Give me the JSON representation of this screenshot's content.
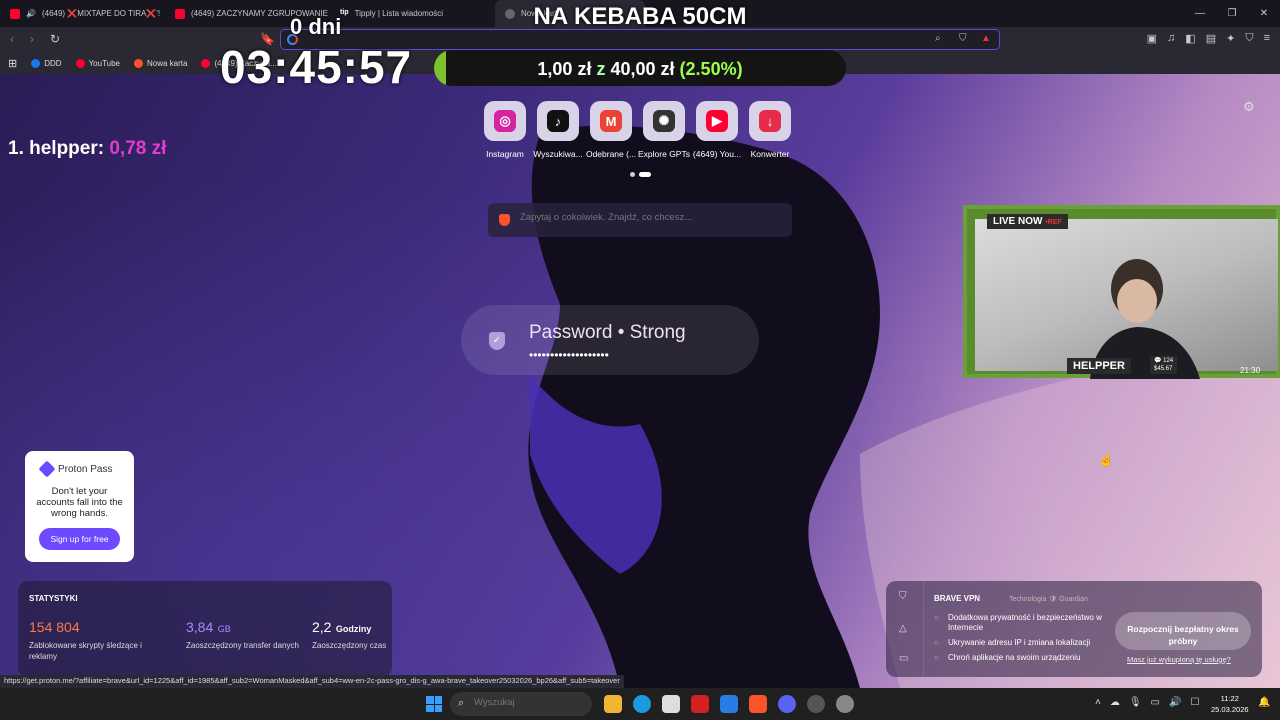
{
  "tabs": [
    {
      "title": "(4649) ❌MIXTAPE DO TIRA❌'!",
      "icon": "youtube-icon"
    },
    {
      "title": "(4649) ZACZYNAMY ZGRUPOWANIE",
      "icon": "youtube-icon"
    },
    {
      "title": "Tipply | Lista wiadomości",
      "icon": "tipply-icon"
    },
    {
      "title": "Nowa karta",
      "icon": "brave-icon"
    }
  ],
  "bookmarks": [
    {
      "label": "DDD",
      "color": "#1877f2"
    },
    {
      "label": "YouTube",
      "color": "#ff0033"
    },
    {
      "label": "Nowa karta",
      "color": "#fb542b"
    },
    {
      "label": "(4649) Zaczyna...",
      "color": "#ff0033"
    }
  ],
  "overlay": {
    "days": "0 dni",
    "timer": "03:45:57",
    "goal_title": "NA KEBABA 50CM",
    "goal_current": "1,00 zł",
    "goal_sep": "z",
    "goal_target": "40,00 zł",
    "goal_percent": "(2.50%)",
    "goal_fraction": 0.025,
    "top_rank": "1. helpper:",
    "top_amount": "0,78 zł"
  },
  "shortcuts": [
    {
      "label": "Instagram",
      "icon": "instagram-icon",
      "color": "#d6249f",
      "glyph": "◎"
    },
    {
      "label": "Wyszukiwa...",
      "icon": "tiktok-icon",
      "color": "#111111",
      "glyph": "♪"
    },
    {
      "label": "Odebrane (...",
      "icon": "gmail-icon",
      "color": "#ea4335",
      "glyph": "M"
    },
    {
      "label": "Explore GPTs",
      "icon": "openai-icon",
      "color": "#333333",
      "glyph": "✺"
    },
    {
      "label": "(4649) You...",
      "icon": "youtube-icon",
      "color": "#ff0033",
      "glyph": "▶"
    },
    {
      "label": "Konwerter",
      "icon": "converter-icon",
      "color": "#e62b4b",
      "glyph": "↓"
    }
  ],
  "search": {
    "placeholder": "Zapytaj o cokolwiek. Znajdź, co chcesz..."
  },
  "password": {
    "title": "Password • Strong",
    "dots": "•••••••••••••••••••"
  },
  "stream": {
    "live": "LIVE NOW",
    "ref": "•REF",
    "name": "HELPPER",
    "stat_a": "💬 124",
    "stat_b": "$45.67",
    "time": "21:30"
  },
  "proton": {
    "brand": "Proton Pass",
    "message": "Don't let your accounts fall into the wrong hands.",
    "button": "Sign up for free"
  },
  "stats": {
    "heading": "STATYSTYKI",
    "items": [
      {
        "value": "154 804",
        "unit": "",
        "label": "Zablokowane skrypty śledzące i reklamy",
        "color": "#ff7a45"
      },
      {
        "value": "3,84",
        "unit": "GB",
        "label": "Zaoszczędzony transfer danych",
        "color": "#a58bff"
      },
      {
        "value": "2,2",
        "unit": "Godziny",
        "label": "Zaoszczędzony czas",
        "color": "#ffffff"
      }
    ]
  },
  "vpn": {
    "title": "BRAVE VPN",
    "tech": "Technologia 🛡 Guardian",
    "features": [
      "Dodatkowa prywatność i bezpieczeństwo w Internecie",
      "Ukrywanie adresu IP i zmiana lokalizacji",
      "Chroń aplikacje na swoim urządzeniu"
    ],
    "cta": "Rozpocznij bezpłatny okres próbny",
    "link": "Masz już wykupioną tę usługę?"
  },
  "status_url": "https://get.proton.me/?affiliate=brave&url_id=1225&aff_id=1985&aff_sub2=WomanMasked&aff_sub4=ww-en-2c-pass-gro_dis-g_awa-brave_takeover25032026_bp26&aff_sub5=takeover",
  "taskbar": {
    "search_placeholder": "Wyszukaj",
    "time": "11:22",
    "date": "25.03.2026"
  }
}
